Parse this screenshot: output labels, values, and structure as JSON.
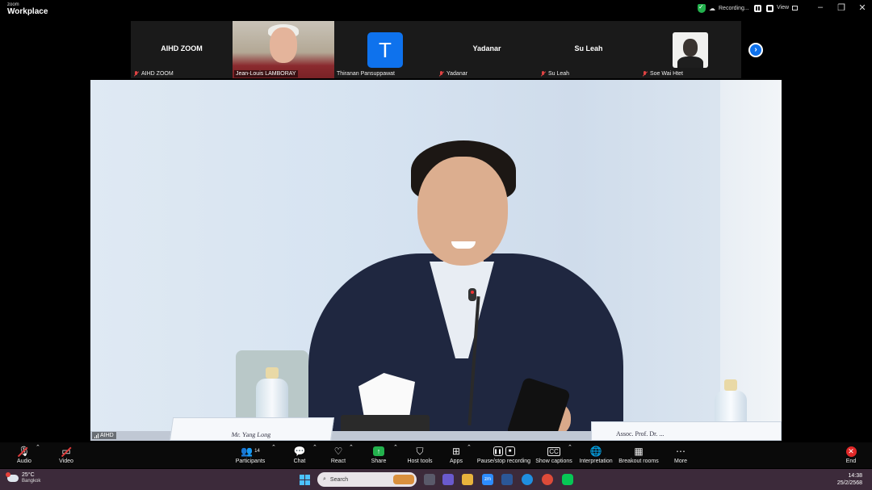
{
  "app": {
    "brand_small": "zoom",
    "brand_big": "Workplace",
    "recording_label": "Recording...",
    "view_label": "View"
  },
  "window_controls": {
    "minimize": "–",
    "maximize": "❐",
    "close": "✕"
  },
  "participants_strip": [
    {
      "display": "AIHD ZOOM",
      "label": "AIHD ZOOM",
      "muted": true,
      "kind": "name"
    },
    {
      "display": "",
      "label": "Jean-Louis LAMBORAY",
      "muted": false,
      "kind": "photo"
    },
    {
      "display": "T",
      "label": "Thiranan Pansuppawat",
      "muted": false,
      "kind": "avatar"
    },
    {
      "display": "Yadanar",
      "label": "Yadanar",
      "muted": true,
      "kind": "name"
    },
    {
      "display": "Su Leah",
      "label": "Su Leah",
      "muted": true,
      "kind": "name"
    },
    {
      "display": "",
      "label": "Soe Wai Htet",
      "muted": true,
      "kind": "photo"
    }
  ],
  "main_video": {
    "label": "AIHD",
    "nameplate_left": "Mr. Yang Long",
    "nameplate_right": "Assoc. Prof. Dr. ..."
  },
  "toolbar": {
    "audio": "Audio",
    "video": "Video",
    "participants": "Participants",
    "participants_count": "14",
    "chat": "Chat",
    "react": "React",
    "share": "Share",
    "host_tools": "Host tools",
    "apps": "Apps",
    "pause_stop_recording": "Pause/stop recording",
    "show_captions": "Show captions",
    "interpretation": "Interpretation",
    "breakout_rooms": "Breakout rooms",
    "more": "More",
    "end": "End"
  },
  "taskbar": {
    "weather_temp": "25°C",
    "weather_place": "Bangkok",
    "search_placeholder": "Search",
    "time": "14:38",
    "date": "25/2/2568"
  },
  "colors": {
    "zoom_blue": "#0e72ed",
    "share_green": "#23b14d",
    "end_red": "#e02828",
    "muted_red": "#e04343"
  }
}
